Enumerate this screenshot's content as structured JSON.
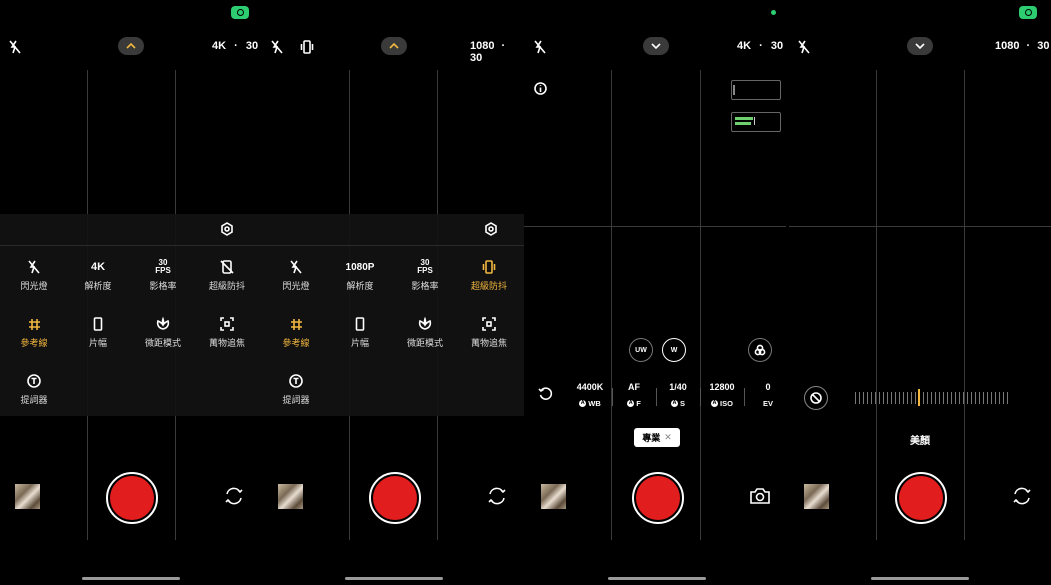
{
  "screens": [
    {
      "resolution": "4K",
      "fps": "30",
      "quick_settings": [
        {
          "icon": "flash-off-icon",
          "label": "閃光燈"
        },
        {
          "icon": "resolution-icon",
          "glyph": "4K",
          "label": "解析度"
        },
        {
          "icon": "fps-icon",
          "glyph": "30 FPS",
          "label": "影格率"
        },
        {
          "icon": "stabilization-off-icon",
          "label": "超級防抖"
        },
        {
          "icon": "grid-icon",
          "label": "參考線",
          "active": true
        },
        {
          "icon": "aspect-ratio-icon",
          "label": "片幅"
        },
        {
          "icon": "macro-icon",
          "label": "微距模式"
        },
        {
          "icon": "focus-tracking-icon",
          "label": "萬物追焦"
        },
        {
          "icon": "teleprompter-icon",
          "label": "提詞器"
        }
      ]
    },
    {
      "resolution": "1080",
      "fps": "30",
      "quick_settings": [
        {
          "icon": "flash-off-icon",
          "label": "閃光燈"
        },
        {
          "icon": "resolution-icon",
          "glyph": "1080P",
          "label": "解析度"
        },
        {
          "icon": "fps-icon",
          "glyph": "30 FPS",
          "label": "影格率"
        },
        {
          "icon": "stabilization-on-icon",
          "label": "超級防抖",
          "active": true
        },
        {
          "icon": "grid-icon",
          "label": "參考線",
          "active": true
        },
        {
          "icon": "aspect-ratio-icon",
          "label": "片幅"
        },
        {
          "icon": "macro-icon",
          "label": "微距模式"
        },
        {
          "icon": "focus-tracking-icon",
          "label": "萬物追焦"
        },
        {
          "icon": "teleprompter-icon",
          "label": "提詞器"
        }
      ]
    },
    {
      "resolution": "4K",
      "fps": "30",
      "zoom": [
        "UW",
        "W"
      ],
      "pro": [
        {
          "value": "4400K",
          "label": "WB"
        },
        {
          "value": "AF",
          "label": "F"
        },
        {
          "value": "1/40",
          "label": "S"
        },
        {
          "value": "12800",
          "label": "ISO"
        },
        {
          "value": "0",
          "label": "EV"
        }
      ],
      "mode_chip": "專業"
    },
    {
      "resolution": "1080",
      "fps": "30",
      "mode_label": "美顏"
    }
  ],
  "separator": "·",
  "colors": {
    "accent": "#f2b73f",
    "shutter": "#e11d1d",
    "status": "#2ecc71"
  }
}
